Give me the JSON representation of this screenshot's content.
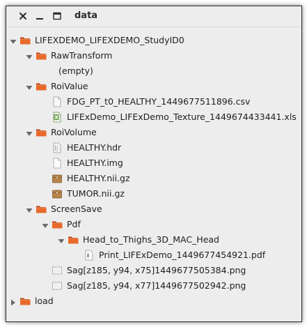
{
  "window": {
    "title": "data",
    "buttons": [
      "close",
      "minimize",
      "maximize"
    ]
  },
  "colors": {
    "folder": "#e8692b",
    "folder_dark": "#b8471a",
    "tar_brown": "#b8864a",
    "xls_green": "#6aa050"
  },
  "tree": [
    {
      "label": "LIFEXDEMO_LIFEXDEMO_StudyID0",
      "depth": 0,
      "icon": "folder-icon",
      "expander": "expanded"
    },
    {
      "label": "RawTransform",
      "depth": 1,
      "icon": "folder-icon",
      "expander": "expanded"
    },
    {
      "label": "(empty)",
      "depth": 2,
      "icon": "none",
      "expander": "none"
    },
    {
      "label": "RoiValue",
      "depth": 1,
      "icon": "folder-icon",
      "expander": "expanded"
    },
    {
      "label": "FDG_PT_t0_HEALTHY_1449677511896.csv",
      "depth": 2,
      "icon": "text-file-icon",
      "expander": "none"
    },
    {
      "label": "LIFExDemo_LIFExDemo_Texture_1449674433441.xls",
      "depth": 2,
      "icon": "spreadsheet-file-icon",
      "expander": "none"
    },
    {
      "label": "RoiVolume",
      "depth": 1,
      "icon": "folder-icon",
      "expander": "expanded"
    },
    {
      "label": "HEALTHY.hdr",
      "depth": 2,
      "icon": "binary-file-icon",
      "expander": "none"
    },
    {
      "label": "HEALTHY.img",
      "depth": 2,
      "icon": "blank-file-icon",
      "expander": "none"
    },
    {
      "label": "HEALTHY.nii.gz",
      "depth": 2,
      "icon": "archive-file-icon",
      "expander": "none"
    },
    {
      "label": "TUMOR.nii.gz",
      "depth": 2,
      "icon": "archive-file-icon",
      "expander": "none"
    },
    {
      "label": "ScreenSave",
      "depth": 1,
      "icon": "folder-icon",
      "expander": "expanded"
    },
    {
      "label": "Pdf",
      "depth": 2,
      "icon": "folder-icon",
      "expander": "expanded"
    },
    {
      "label": "Head_to_Thighs_3D_MAC_Head",
      "depth": 3,
      "icon": "folder-icon",
      "expander": "expanded"
    },
    {
      "label": "Print_LIFExDemo_1449677454921.pdf",
      "depth": 4,
      "icon": "pdf-file-icon",
      "expander": "none"
    },
    {
      "label": "Sag[z185, y94, x75]1449677505384.png",
      "depth": 2,
      "icon": "image-file-icon",
      "expander": "none"
    },
    {
      "label": "Sag[z185, y94, x77]1449677502942.png",
      "depth": 2,
      "icon": "image-file-icon",
      "expander": "none"
    },
    {
      "label": "load",
      "depth": 0,
      "icon": "folder-icon",
      "expander": "collapsed"
    }
  ]
}
